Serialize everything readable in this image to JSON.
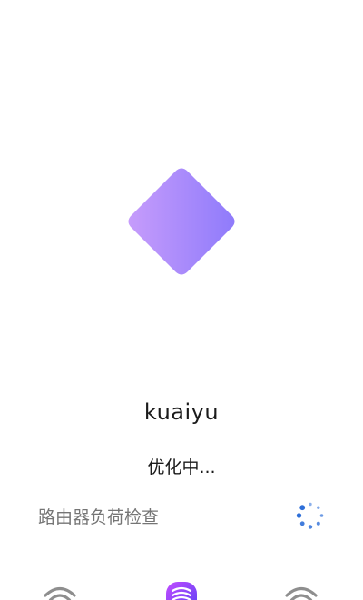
{
  "app": {
    "name": "kuaiyu"
  },
  "status": {
    "text": "优化中..."
  },
  "task": {
    "label": "路由器负荷检查",
    "state": "in-progress"
  },
  "icons": {
    "logo": "diamond-logo",
    "spinner": "loading-spinner-icon",
    "bottom": [
      "wifi-icon",
      "router-icon",
      "wifi-icon"
    ]
  },
  "colors": {
    "logo_gradient_start": "#c69cfb",
    "logo_gradient_end": "#8f7bfb",
    "spinner": "#2e6fd8",
    "router_gradient_start": "#c24bff",
    "router_gradient_end": "#5a43f5",
    "wifi_gray": "#8e8e8e",
    "text_primary": "#1b1b1b",
    "text_secondary": "#757575"
  }
}
